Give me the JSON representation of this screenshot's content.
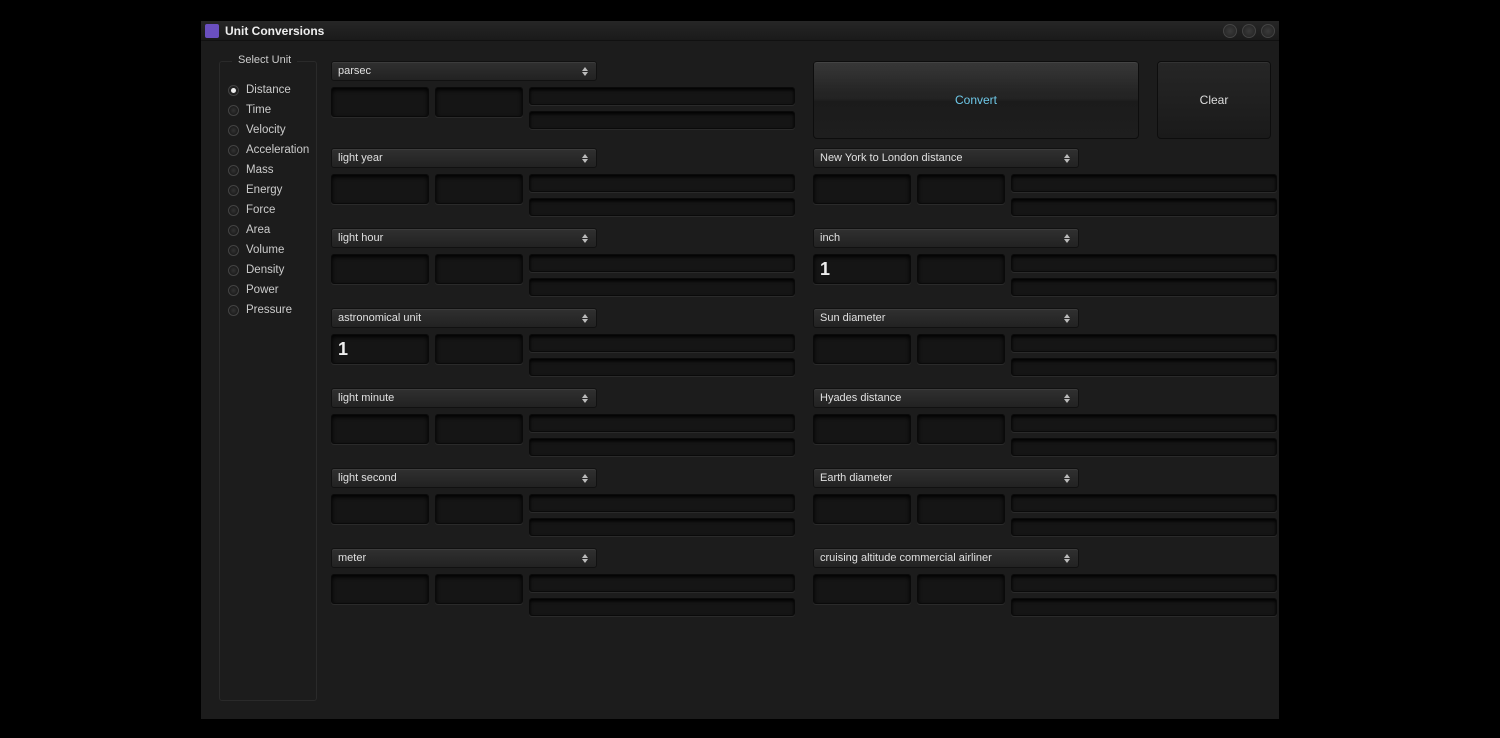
{
  "window": {
    "title": "Unit Conversions"
  },
  "sidebar": {
    "group_title": "Select Unit",
    "items": [
      {
        "label": "Distance",
        "checked": true
      },
      {
        "label": "Time",
        "checked": false
      },
      {
        "label": "Velocity",
        "checked": false
      },
      {
        "label": "Acceleration",
        "checked": false
      },
      {
        "label": "Mass",
        "checked": false
      },
      {
        "label": "Energy",
        "checked": false
      },
      {
        "label": "Force",
        "checked": false
      },
      {
        "label": "Area",
        "checked": false
      },
      {
        "label": "Volume",
        "checked": false
      },
      {
        "label": "Density",
        "checked": false
      },
      {
        "label": "Power",
        "checked": false
      },
      {
        "label": "Pressure",
        "checked": false
      }
    ]
  },
  "buttons": {
    "convert": "Convert",
    "clear": "Clear"
  },
  "left_units": [
    {
      "name": "parsec",
      "v1": "",
      "v2": ""
    },
    {
      "name": "light year",
      "v1": "",
      "v2": ""
    },
    {
      "name": "light hour",
      "v1": "",
      "v2": ""
    },
    {
      "name": "astronomical unit",
      "v1": "1",
      "v2": ""
    },
    {
      "name": "light minute",
      "v1": "",
      "v2": ""
    },
    {
      "name": "light second",
      "v1": "",
      "v2": ""
    },
    {
      "name": "meter",
      "v1": "",
      "v2": ""
    }
  ],
  "right_units": [
    {
      "name": "New York to London distance",
      "v1": "",
      "v2": ""
    },
    {
      "name": "inch",
      "v1": "1",
      "v2": ""
    },
    {
      "name": "Sun diameter",
      "v1": "",
      "v2": ""
    },
    {
      "name": "Hyades distance",
      "v1": "",
      "v2": ""
    },
    {
      "name": "Earth diameter",
      "v1": "",
      "v2": ""
    },
    {
      "name": "cruising altitude commercial airliner",
      "v1": "",
      "v2": ""
    }
  ]
}
